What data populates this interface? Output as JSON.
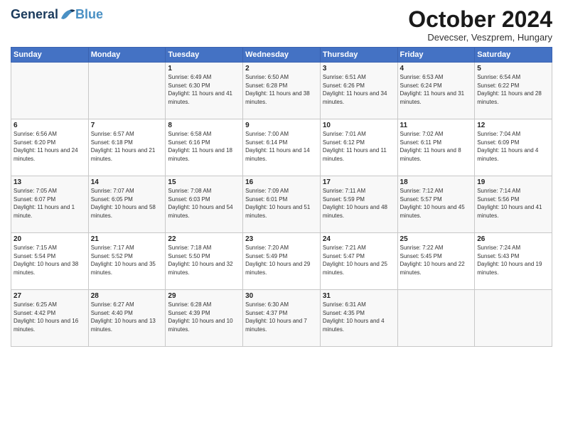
{
  "logo": {
    "general": "General",
    "blue": "Blue"
  },
  "title": "October 2024",
  "subtitle": "Devecser, Veszprem, Hungary",
  "days_of_week": [
    "Sunday",
    "Monday",
    "Tuesday",
    "Wednesday",
    "Thursday",
    "Friday",
    "Saturday"
  ],
  "weeks": [
    [
      {
        "day": "",
        "info": ""
      },
      {
        "day": "",
        "info": ""
      },
      {
        "day": "1",
        "info": "Sunrise: 6:49 AM\nSunset: 6:30 PM\nDaylight: 11 hours and 41 minutes."
      },
      {
        "day": "2",
        "info": "Sunrise: 6:50 AM\nSunset: 6:28 PM\nDaylight: 11 hours and 38 minutes."
      },
      {
        "day": "3",
        "info": "Sunrise: 6:51 AM\nSunset: 6:26 PM\nDaylight: 11 hours and 34 minutes."
      },
      {
        "day": "4",
        "info": "Sunrise: 6:53 AM\nSunset: 6:24 PM\nDaylight: 11 hours and 31 minutes."
      },
      {
        "day": "5",
        "info": "Sunrise: 6:54 AM\nSunset: 6:22 PM\nDaylight: 11 hours and 28 minutes."
      }
    ],
    [
      {
        "day": "6",
        "info": "Sunrise: 6:56 AM\nSunset: 6:20 PM\nDaylight: 11 hours and 24 minutes."
      },
      {
        "day": "7",
        "info": "Sunrise: 6:57 AM\nSunset: 6:18 PM\nDaylight: 11 hours and 21 minutes."
      },
      {
        "day": "8",
        "info": "Sunrise: 6:58 AM\nSunset: 6:16 PM\nDaylight: 11 hours and 18 minutes."
      },
      {
        "day": "9",
        "info": "Sunrise: 7:00 AM\nSunset: 6:14 PM\nDaylight: 11 hours and 14 minutes."
      },
      {
        "day": "10",
        "info": "Sunrise: 7:01 AM\nSunset: 6:12 PM\nDaylight: 11 hours and 11 minutes."
      },
      {
        "day": "11",
        "info": "Sunrise: 7:02 AM\nSunset: 6:11 PM\nDaylight: 11 hours and 8 minutes."
      },
      {
        "day": "12",
        "info": "Sunrise: 7:04 AM\nSunset: 6:09 PM\nDaylight: 11 hours and 4 minutes."
      }
    ],
    [
      {
        "day": "13",
        "info": "Sunrise: 7:05 AM\nSunset: 6:07 PM\nDaylight: 11 hours and 1 minute."
      },
      {
        "day": "14",
        "info": "Sunrise: 7:07 AM\nSunset: 6:05 PM\nDaylight: 10 hours and 58 minutes."
      },
      {
        "day": "15",
        "info": "Sunrise: 7:08 AM\nSunset: 6:03 PM\nDaylight: 10 hours and 54 minutes."
      },
      {
        "day": "16",
        "info": "Sunrise: 7:09 AM\nSunset: 6:01 PM\nDaylight: 10 hours and 51 minutes."
      },
      {
        "day": "17",
        "info": "Sunrise: 7:11 AM\nSunset: 5:59 PM\nDaylight: 10 hours and 48 minutes."
      },
      {
        "day": "18",
        "info": "Sunrise: 7:12 AM\nSunset: 5:57 PM\nDaylight: 10 hours and 45 minutes."
      },
      {
        "day": "19",
        "info": "Sunrise: 7:14 AM\nSunset: 5:56 PM\nDaylight: 10 hours and 41 minutes."
      }
    ],
    [
      {
        "day": "20",
        "info": "Sunrise: 7:15 AM\nSunset: 5:54 PM\nDaylight: 10 hours and 38 minutes."
      },
      {
        "day": "21",
        "info": "Sunrise: 7:17 AM\nSunset: 5:52 PM\nDaylight: 10 hours and 35 minutes."
      },
      {
        "day": "22",
        "info": "Sunrise: 7:18 AM\nSunset: 5:50 PM\nDaylight: 10 hours and 32 minutes."
      },
      {
        "day": "23",
        "info": "Sunrise: 7:20 AM\nSunset: 5:49 PM\nDaylight: 10 hours and 29 minutes."
      },
      {
        "day": "24",
        "info": "Sunrise: 7:21 AM\nSunset: 5:47 PM\nDaylight: 10 hours and 25 minutes."
      },
      {
        "day": "25",
        "info": "Sunrise: 7:22 AM\nSunset: 5:45 PM\nDaylight: 10 hours and 22 minutes."
      },
      {
        "day": "26",
        "info": "Sunrise: 7:24 AM\nSunset: 5:43 PM\nDaylight: 10 hours and 19 minutes."
      }
    ],
    [
      {
        "day": "27",
        "info": "Sunrise: 6:25 AM\nSunset: 4:42 PM\nDaylight: 10 hours and 16 minutes."
      },
      {
        "day": "28",
        "info": "Sunrise: 6:27 AM\nSunset: 4:40 PM\nDaylight: 10 hours and 13 minutes."
      },
      {
        "day": "29",
        "info": "Sunrise: 6:28 AM\nSunset: 4:39 PM\nDaylight: 10 hours and 10 minutes."
      },
      {
        "day": "30",
        "info": "Sunrise: 6:30 AM\nSunset: 4:37 PM\nDaylight: 10 hours and 7 minutes."
      },
      {
        "day": "31",
        "info": "Sunrise: 6:31 AM\nSunset: 4:35 PM\nDaylight: 10 hours and 4 minutes."
      },
      {
        "day": "",
        "info": ""
      },
      {
        "day": "",
        "info": ""
      }
    ]
  ]
}
